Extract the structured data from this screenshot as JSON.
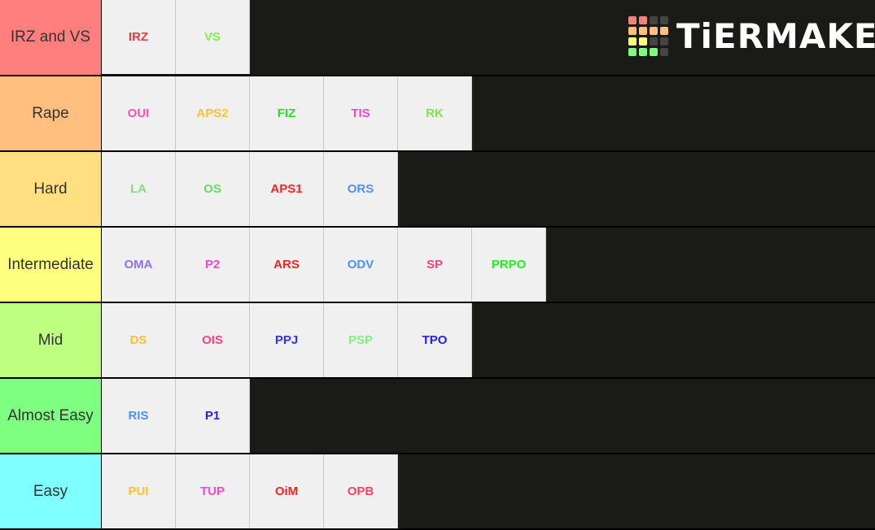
{
  "logo": {
    "text": "TiERMAKER",
    "grid_colors": [
      "#ff7f7f",
      "#ff7f7f",
      "#444444",
      "#444444",
      "#ffbf7f",
      "#ffbf7f",
      "#ffbf7f",
      "#ffbf7f",
      "#ffff7f",
      "#ffff7f",
      "#444444",
      "#444444",
      "#7fff7f",
      "#7fff7f",
      "#7fff7f",
      "#444444"
    ]
  },
  "tiers": [
    {
      "label": "IRZ and VS",
      "color": "#ff7f7f",
      "items": [
        {
          "text": "IRZ",
          "color": "#e03c3c"
        },
        {
          "text": "VS",
          "color": "#7ff052"
        }
      ]
    },
    {
      "label": "Rape",
      "color": "#ffbf7f",
      "items": [
        {
          "text": "OUI",
          "color": "#ff4fb0"
        },
        {
          "text": "APS2",
          "color": "#ffbf2f"
        },
        {
          "text": "FIZ",
          "color": "#22e022"
        },
        {
          "text": "TIS",
          "color": "#ff44c0"
        },
        {
          "text": "RK",
          "color": "#7fe050"
        }
      ]
    },
    {
      "label": "Hard",
      "color": "#ffdf7f",
      "items": [
        {
          "text": "LA",
          "color": "#7fe07f"
        },
        {
          "text": "OS",
          "color": "#5fe05f"
        },
        {
          "text": "APS1",
          "color": "#ff2020"
        },
        {
          "text": "ORS",
          "color": "#4f8fff"
        }
      ]
    },
    {
      "label": "Intermediate",
      "color": "#ffff7f",
      "items": [
        {
          "text": "OMA",
          "color": "#8f6fff"
        },
        {
          "text": "P2",
          "color": "#ff44cc"
        },
        {
          "text": "ARS",
          "color": "#ff2020"
        },
        {
          "text": "ODV",
          "color": "#4f8fff"
        },
        {
          "text": "SP",
          "color": "#ff3f7f"
        },
        {
          "text": "PRPO",
          "color": "#22ee22"
        }
      ]
    },
    {
      "label": "Mid",
      "color": "#bfff7f",
      "items": [
        {
          "text": "DS",
          "color": "#ffbf2f"
        },
        {
          "text": "OIS",
          "color": "#ff3f7f"
        },
        {
          "text": "PPJ",
          "color": "#3030ff"
        },
        {
          "text": "PSP",
          "color": "#7fef7f"
        },
        {
          "text": "TPO",
          "color": "#2020ee"
        }
      ]
    },
    {
      "label": "Almost Easy",
      "color": "#7fff7f",
      "items": [
        {
          "text": "RIS",
          "color": "#4f8fff"
        },
        {
          "text": "P1",
          "color": "#2020ee"
        }
      ]
    },
    {
      "label": "Easy",
      "color": "#7fffff",
      "items": [
        {
          "text": "PUI",
          "color": "#ffbf2f"
        },
        {
          "text": "TUP",
          "color": "#ff44cc"
        },
        {
          "text": "OiM",
          "color": "#ff2020"
        },
        {
          "text": "OPB",
          "color": "#ff3f5f"
        }
      ]
    }
  ]
}
